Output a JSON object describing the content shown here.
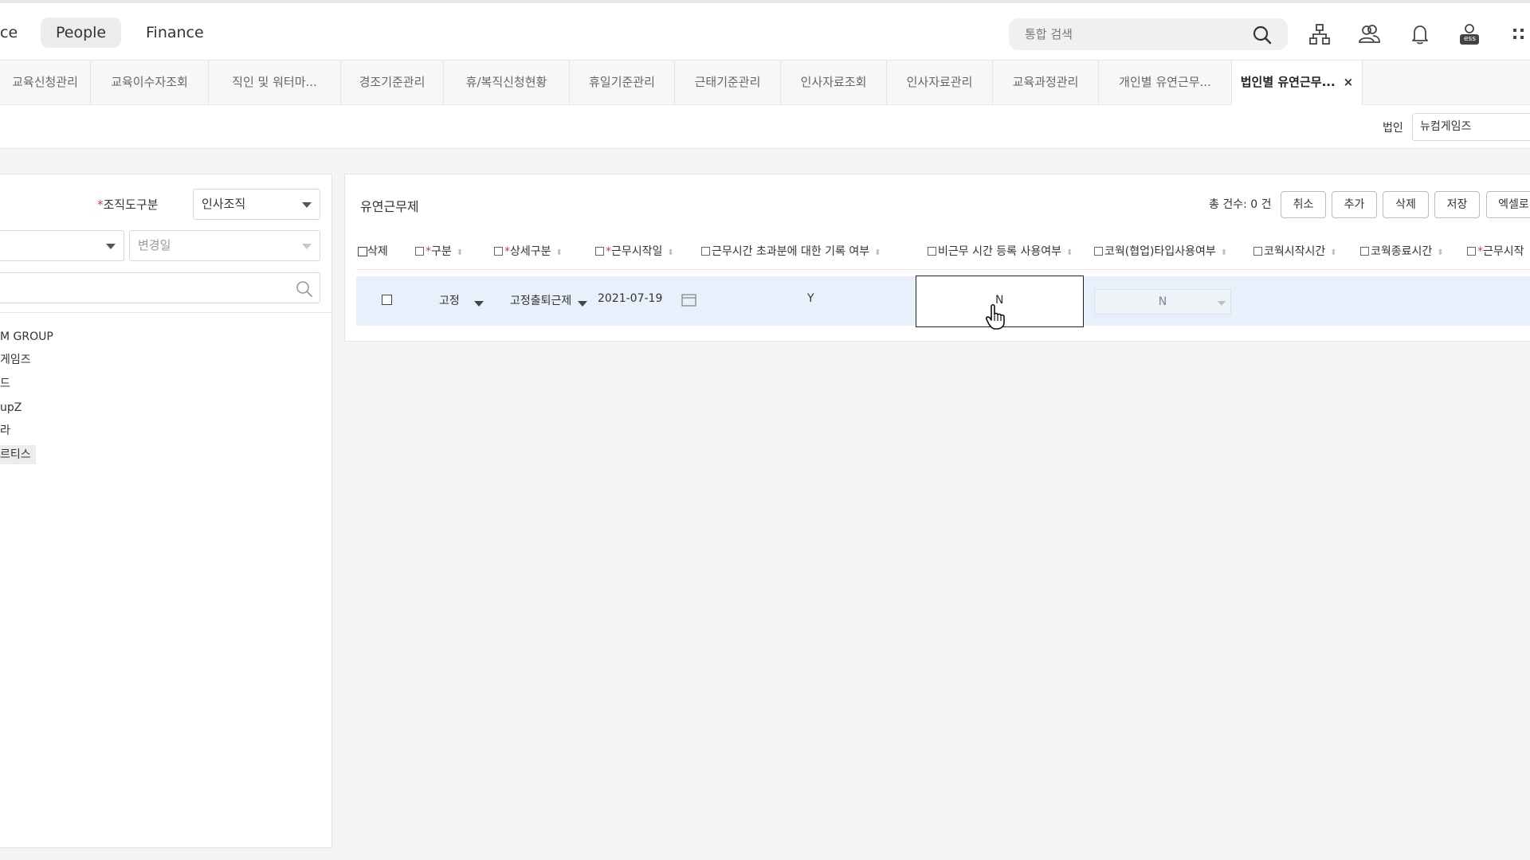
{
  "topnav": {
    "items": [
      {
        "label": "ce"
      },
      {
        "label": "People",
        "active": true
      },
      {
        "label": "Finance"
      }
    ],
    "search_placeholder": "통합 검색",
    "icons": [
      "search-icon",
      "org-chart-icon",
      "people-icon",
      "bell-icon",
      "ess-icon",
      "apps-grid-icon"
    ],
    "ess_label": "ess"
  },
  "tabs": [
    {
      "label": "교육신청관리"
    },
    {
      "label": "교육이수자조회"
    },
    {
      "label": "직인 및 워터마..."
    },
    {
      "label": "경조기준관리"
    },
    {
      "label": "휴/복직신청현황"
    },
    {
      "label": "휴일기준관리"
    },
    {
      "label": "근태기준관리"
    },
    {
      "label": "인사자료조회"
    },
    {
      "label": "인사자료관리"
    },
    {
      "label": "교육과정관리"
    },
    {
      "label": "개인별 유연근무..."
    },
    {
      "label": "법인별 유연근무...",
      "active": true,
      "close": "×"
    }
  ],
  "filter": {
    "corp_label": "법인",
    "corp_value": "뉴컴게임즈"
  },
  "left": {
    "org_type_label": "조직도구분",
    "org_type_value": "인사조직",
    "change_date_placeholder": "변경일",
    "tree": [
      "M GROUP",
      "게임즈",
      "드",
      "upZ",
      "라",
      "르티스"
    ]
  },
  "grid": {
    "title": "유연근무제",
    "count": "총 건수: 0 건",
    "buttons": [
      "취소",
      "추가",
      "삭제",
      "저장",
      "엑셀로"
    ],
    "headers": [
      {
        "label": "삭제",
        "type": "checkbox"
      },
      {
        "label": "구분",
        "required": true,
        "edit": true
      },
      {
        "label": "상세구분",
        "required": true,
        "edit": true
      },
      {
        "label": "근무시작일",
        "required": true,
        "edit": true
      },
      {
        "label": "근무시간 초과분에 대한 기록 여부",
        "edit": true
      },
      {
        "label": "비근무 시간 등록 사용여부",
        "edit": true
      },
      {
        "label": "코웍(협업)타입사용여부",
        "edit": true
      },
      {
        "label": "코웍시작시간",
        "edit": true
      },
      {
        "label": "코웍종료시간",
        "edit": true
      },
      {
        "label": "근무시작",
        "required": true,
        "edit": true
      }
    ],
    "row": {
      "type": "고정",
      "detail": "고정출퇴근제",
      "start_date": "2021-07-19",
      "overtime_record": "Y",
      "non_work_time": "N",
      "cowork_type": "N"
    }
  },
  "colors": {
    "accent_required": "#e6353e",
    "row_selected": "#e8f1fb"
  }
}
